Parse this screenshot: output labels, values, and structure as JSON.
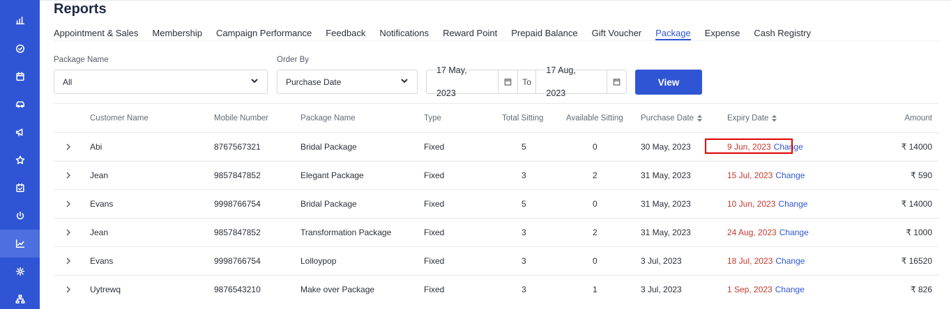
{
  "sidebar": {
    "items": [
      {
        "icon": "bar-chart-icon",
        "active": false
      },
      {
        "icon": "check-circle-icon",
        "active": false
      },
      {
        "icon": "calendar-icon",
        "active": false
      },
      {
        "icon": "car-icon",
        "active": false
      },
      {
        "icon": "megaphone-icon",
        "active": false
      },
      {
        "icon": "star-icon",
        "active": false
      },
      {
        "icon": "calendar-check-icon",
        "active": false
      },
      {
        "icon": "power-icon",
        "active": false
      },
      {
        "icon": "trend-chart-icon",
        "active": true
      },
      {
        "icon": "gear-icon",
        "active": false
      },
      {
        "icon": "hierarchy-icon",
        "active": false
      }
    ]
  },
  "page_title": "Reports",
  "tabs": [
    {
      "label": "Appointment & Sales",
      "active": false
    },
    {
      "label": "Membership",
      "active": false
    },
    {
      "label": "Campaign Performance",
      "active": false
    },
    {
      "label": "Feedback",
      "active": false
    },
    {
      "label": "Notifications",
      "active": false
    },
    {
      "label": "Reward Point",
      "active": false
    },
    {
      "label": "Prepaid Balance",
      "active": false
    },
    {
      "label": "Gift Voucher",
      "active": false
    },
    {
      "label": "Package",
      "active": true
    },
    {
      "label": "Expense",
      "active": false
    },
    {
      "label": "Cash Registry",
      "active": false
    }
  ],
  "filters": {
    "package_name_label": "Package Name",
    "package_name_value": "All",
    "order_by_label": "Order By",
    "order_by_value": "Purchase Date",
    "date_from": "17 May, 2023",
    "to_label": "To",
    "date_to": "17 Aug, 2023",
    "view_label": "View"
  },
  "table": {
    "columns": {
      "customer_name": "Customer Name",
      "mobile_number": "Mobile Number",
      "package_name": "Package Name",
      "type": "Type",
      "total_sitting": "Total Sitting",
      "available_sitting": "Available Sitting",
      "purchase_date": "Purchase Date",
      "expiry_date": "Expiry Date",
      "amount": "Amount"
    },
    "rows": [
      {
        "customer": "Abi",
        "mobile": "8767567321",
        "package": "Bridal Package",
        "type": "Fixed",
        "total": "5",
        "available": "0",
        "purchase": "30 May, 2023",
        "expiry": "9 Jun, 2023",
        "change": "Change",
        "amount": "₹ 14000"
      },
      {
        "customer": "Jean",
        "mobile": "9857847852",
        "package": "Elegant Package",
        "type": "Fixed",
        "total": "3",
        "available": "2",
        "purchase": "31 May, 2023",
        "expiry": "15 Jul, 2023",
        "change": "Change",
        "amount": "₹ 590"
      },
      {
        "customer": "Evans",
        "mobile": "9998766754",
        "package": "Bridal Package",
        "type": "Fixed",
        "total": "5",
        "available": "0",
        "purchase": "31 May, 2023",
        "expiry": "10 Jun, 2023",
        "change": "Change",
        "amount": "₹ 14000"
      },
      {
        "customer": "Jean",
        "mobile": "9857847852",
        "package": "Transformation Package",
        "type": "Fixed",
        "total": "3",
        "available": "2",
        "purchase": "31 May, 2023",
        "expiry": "24 Aug, 2023",
        "change": "Change",
        "amount": "₹ 1000"
      },
      {
        "customer": "Evans",
        "mobile": "9998766754",
        "package": "Lolloypop",
        "type": "Fixed",
        "total": "3",
        "available": "0",
        "purchase": "3 Jul, 2023",
        "expiry": "18 Jul, 2023",
        "change": "Change",
        "amount": "₹ 16520"
      },
      {
        "customer": "Uytrewq",
        "mobile": "9876543210",
        "package": "Make over Package",
        "type": "Fixed",
        "total": "3",
        "available": "1",
        "purchase": "3 Jul, 2023",
        "expiry": "1 Sep, 2023",
        "change": "Change",
        "amount": "₹ 826"
      }
    ]
  },
  "colors": {
    "brand": "#2f55d4",
    "expiry_text": "#c0392b",
    "highlight_border": "#e00000"
  }
}
